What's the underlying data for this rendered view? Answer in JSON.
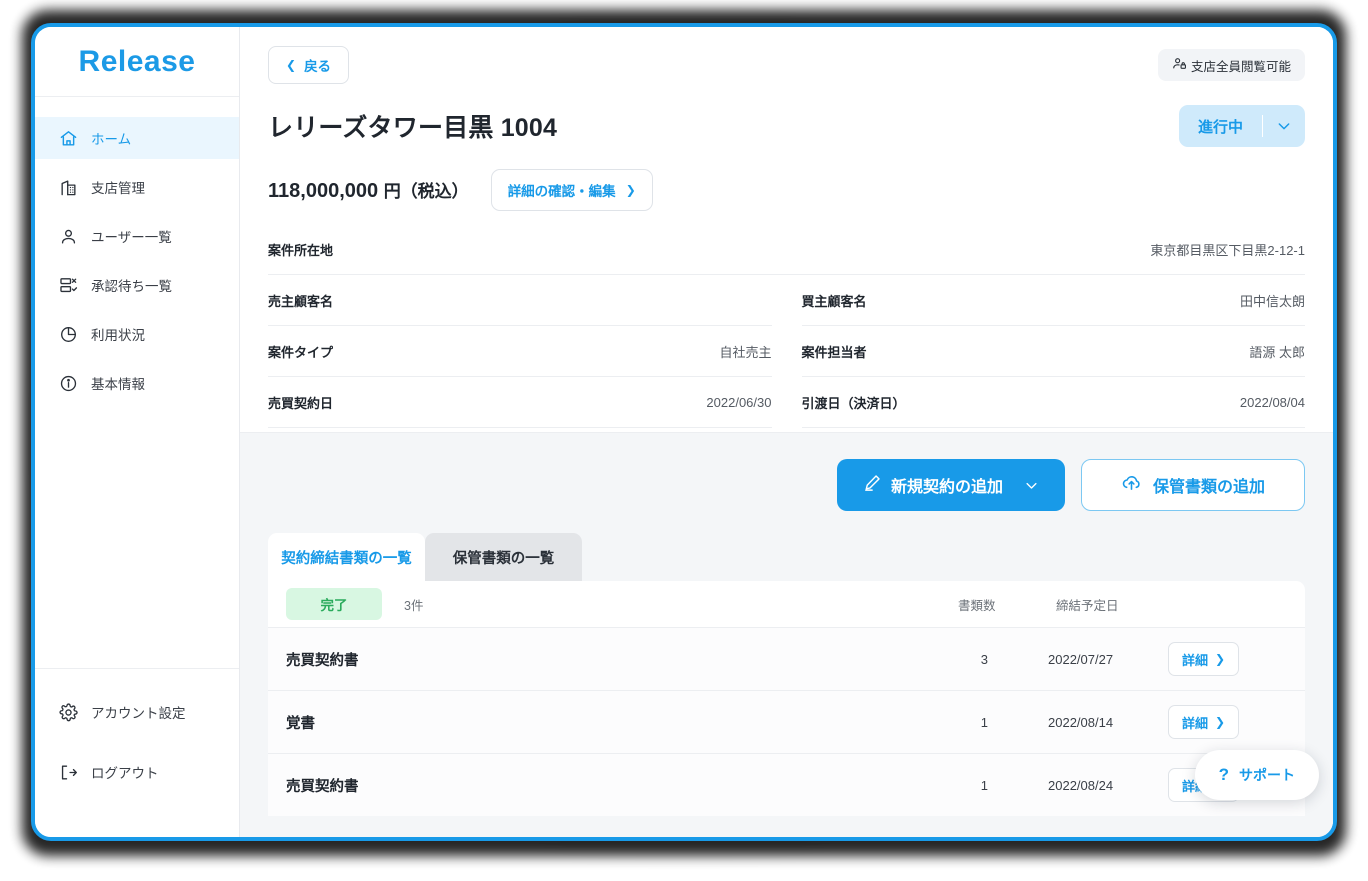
{
  "brand": {
    "logo_text": "Release"
  },
  "sidebar": {
    "items": [
      {
        "label": "ホーム",
        "icon": "home-icon",
        "active": true
      },
      {
        "label": "支店管理",
        "icon": "building-icon",
        "active": false
      },
      {
        "label": "ユーザー一覧",
        "icon": "user-icon",
        "active": false
      },
      {
        "label": "承認待ち一覧",
        "icon": "approval-icon",
        "active": false
      },
      {
        "label": "利用状況",
        "icon": "pie-chart-icon",
        "active": false
      },
      {
        "label": "基本情報",
        "icon": "info-icon",
        "active": false
      }
    ],
    "bottom_items": [
      {
        "label": "アカウント設定",
        "icon": "gear-icon"
      },
      {
        "label": "ログアウト",
        "icon": "logout-icon"
      }
    ]
  },
  "header": {
    "back_label": "戻る",
    "visibility_badge": "支店全員閲覧可能",
    "title": "レリーズタワー目黒 1004",
    "status_label": "進行中",
    "price": "118,000,000",
    "price_unit": "円（税込）",
    "edit_label": "詳細の確認・編集"
  },
  "info": {
    "address_label": "案件所在地",
    "address_value": "東京都目黒区下目黒2-12-1",
    "left_rows": [
      {
        "label": "売主顧客名",
        "value": ""
      },
      {
        "label": "案件タイプ",
        "value": "自社売主"
      },
      {
        "label": "売買契約日",
        "value": "2022/06/30"
      }
    ],
    "right_rows": [
      {
        "label": "買主顧客名",
        "value": "田中信太朗"
      },
      {
        "label": "案件担当者",
        "value": "語源 太郎"
      },
      {
        "label": "引渡日（決済日）",
        "value": "2022/08/04"
      }
    ]
  },
  "actions": {
    "new_contract_label": "新規契約の追加",
    "add_storage_label": "保管書類の追加"
  },
  "tabs": [
    {
      "label": "契約締結書類の一覧",
      "active": true
    },
    {
      "label": "保管書類の一覧",
      "active": false
    }
  ],
  "table": {
    "status_badge": "完了",
    "count_text": "3件",
    "col_docs": "書類数",
    "col_date": "締結予定日",
    "detail_label": "詳細",
    "rows": [
      {
        "name": "売買契約書",
        "count": "3",
        "date": "2022/07/27"
      },
      {
        "name": "覚書",
        "count": "1",
        "date": "2022/08/14"
      },
      {
        "name": "売買契約書",
        "count": "1",
        "date": "2022/08/24"
      }
    ]
  },
  "support": {
    "label": "サポート"
  },
  "colors": {
    "accent": "#189ae8",
    "status_bg": "#cfeafb",
    "done_bg": "#d8f7e2",
    "done_text": "#2aab5c",
    "page_bg": "#f4f6f8"
  }
}
